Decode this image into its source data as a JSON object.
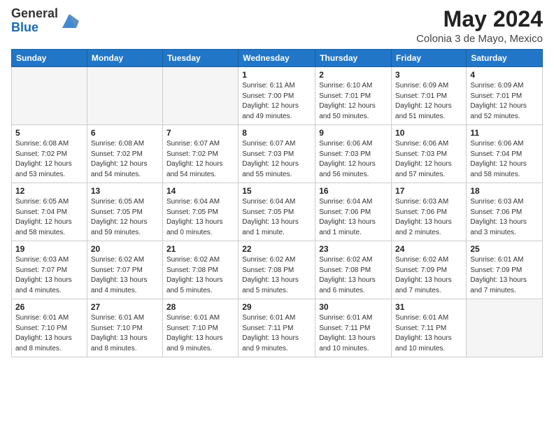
{
  "logo": {
    "general": "General",
    "blue": "Blue"
  },
  "header": {
    "month": "May 2024",
    "location": "Colonia 3 de Mayo, Mexico"
  },
  "weekdays": [
    "Sunday",
    "Monday",
    "Tuesday",
    "Wednesday",
    "Thursday",
    "Friday",
    "Saturday"
  ],
  "weeks": [
    [
      {
        "day": "",
        "empty": true
      },
      {
        "day": "",
        "empty": true
      },
      {
        "day": "",
        "empty": true
      },
      {
        "day": "1",
        "info": "Sunrise: 6:11 AM\nSunset: 7:00 PM\nDaylight: 12 hours\nand 49 minutes."
      },
      {
        "day": "2",
        "info": "Sunrise: 6:10 AM\nSunset: 7:01 PM\nDaylight: 12 hours\nand 50 minutes."
      },
      {
        "day": "3",
        "info": "Sunrise: 6:09 AM\nSunset: 7:01 PM\nDaylight: 12 hours\nand 51 minutes."
      },
      {
        "day": "4",
        "info": "Sunrise: 6:09 AM\nSunset: 7:01 PM\nDaylight: 12 hours\nand 52 minutes."
      }
    ],
    [
      {
        "day": "5",
        "info": "Sunrise: 6:08 AM\nSunset: 7:02 PM\nDaylight: 12 hours\nand 53 minutes."
      },
      {
        "day": "6",
        "info": "Sunrise: 6:08 AM\nSunset: 7:02 PM\nDaylight: 12 hours\nand 54 minutes."
      },
      {
        "day": "7",
        "info": "Sunrise: 6:07 AM\nSunset: 7:02 PM\nDaylight: 12 hours\nand 54 minutes."
      },
      {
        "day": "8",
        "info": "Sunrise: 6:07 AM\nSunset: 7:03 PM\nDaylight: 12 hours\nand 55 minutes."
      },
      {
        "day": "9",
        "info": "Sunrise: 6:06 AM\nSunset: 7:03 PM\nDaylight: 12 hours\nand 56 minutes."
      },
      {
        "day": "10",
        "info": "Sunrise: 6:06 AM\nSunset: 7:03 PM\nDaylight: 12 hours\nand 57 minutes."
      },
      {
        "day": "11",
        "info": "Sunrise: 6:06 AM\nSunset: 7:04 PM\nDaylight: 12 hours\nand 58 minutes."
      }
    ],
    [
      {
        "day": "12",
        "info": "Sunrise: 6:05 AM\nSunset: 7:04 PM\nDaylight: 12 hours\nand 58 minutes."
      },
      {
        "day": "13",
        "info": "Sunrise: 6:05 AM\nSunset: 7:05 PM\nDaylight: 12 hours\nand 59 minutes."
      },
      {
        "day": "14",
        "info": "Sunrise: 6:04 AM\nSunset: 7:05 PM\nDaylight: 13 hours\nand 0 minutes."
      },
      {
        "day": "15",
        "info": "Sunrise: 6:04 AM\nSunset: 7:05 PM\nDaylight: 13 hours\nand 1 minute."
      },
      {
        "day": "16",
        "info": "Sunrise: 6:04 AM\nSunset: 7:06 PM\nDaylight: 13 hours\nand 1 minute."
      },
      {
        "day": "17",
        "info": "Sunrise: 6:03 AM\nSunset: 7:06 PM\nDaylight: 13 hours\nand 2 minutes."
      },
      {
        "day": "18",
        "info": "Sunrise: 6:03 AM\nSunset: 7:06 PM\nDaylight: 13 hours\nand 3 minutes."
      }
    ],
    [
      {
        "day": "19",
        "info": "Sunrise: 6:03 AM\nSunset: 7:07 PM\nDaylight: 13 hours\nand 4 minutes."
      },
      {
        "day": "20",
        "info": "Sunrise: 6:02 AM\nSunset: 7:07 PM\nDaylight: 13 hours\nand 4 minutes."
      },
      {
        "day": "21",
        "info": "Sunrise: 6:02 AM\nSunset: 7:08 PM\nDaylight: 13 hours\nand 5 minutes."
      },
      {
        "day": "22",
        "info": "Sunrise: 6:02 AM\nSunset: 7:08 PM\nDaylight: 13 hours\nand 5 minutes."
      },
      {
        "day": "23",
        "info": "Sunrise: 6:02 AM\nSunset: 7:08 PM\nDaylight: 13 hours\nand 6 minutes."
      },
      {
        "day": "24",
        "info": "Sunrise: 6:02 AM\nSunset: 7:09 PM\nDaylight: 13 hours\nand 7 minutes."
      },
      {
        "day": "25",
        "info": "Sunrise: 6:01 AM\nSunset: 7:09 PM\nDaylight: 13 hours\nand 7 minutes."
      }
    ],
    [
      {
        "day": "26",
        "info": "Sunrise: 6:01 AM\nSunset: 7:10 PM\nDaylight: 13 hours\nand 8 minutes."
      },
      {
        "day": "27",
        "info": "Sunrise: 6:01 AM\nSunset: 7:10 PM\nDaylight: 13 hours\nand 8 minutes."
      },
      {
        "day": "28",
        "info": "Sunrise: 6:01 AM\nSunset: 7:10 PM\nDaylight: 13 hours\nand 9 minutes."
      },
      {
        "day": "29",
        "info": "Sunrise: 6:01 AM\nSunset: 7:11 PM\nDaylight: 13 hours\nand 9 minutes."
      },
      {
        "day": "30",
        "info": "Sunrise: 6:01 AM\nSunset: 7:11 PM\nDaylight: 13 hours\nand 10 minutes."
      },
      {
        "day": "31",
        "info": "Sunrise: 6:01 AM\nSunset: 7:11 PM\nDaylight: 13 hours\nand 10 minutes."
      },
      {
        "day": "",
        "empty": true
      }
    ]
  ]
}
